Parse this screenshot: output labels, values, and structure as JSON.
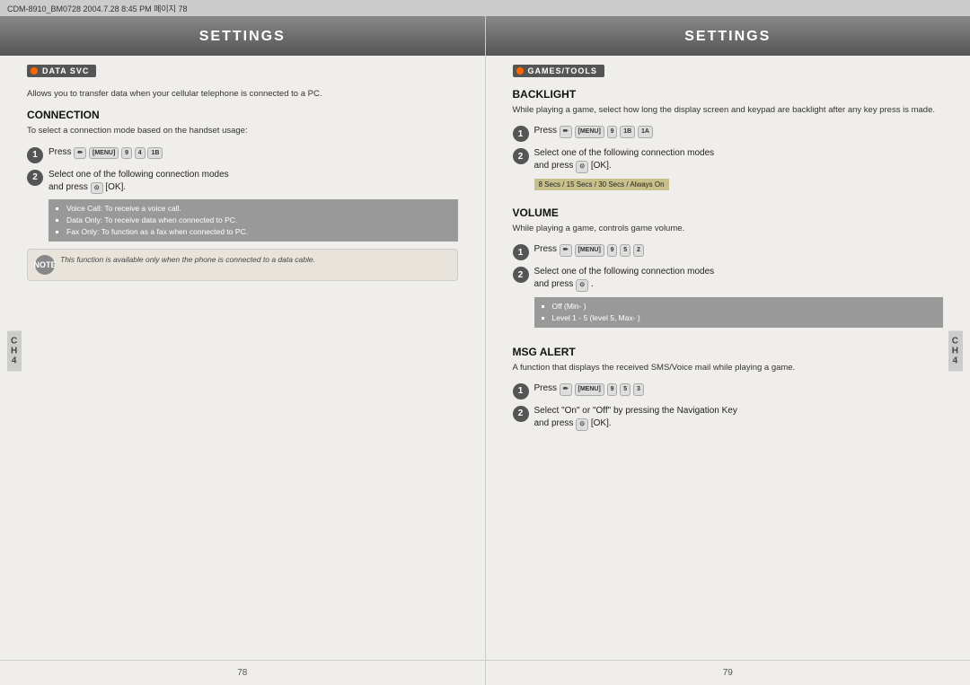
{
  "topbar": {
    "text": "CDM-8910_BM0728  2004.7.28 8:45 PM  페이지 78"
  },
  "leftPage": {
    "header": "SETTINGS",
    "badge": "DATA SVC",
    "badgeDesc": "Allows you to transfer data when your cellular telephone is connected to a PC.",
    "connection": {
      "title": "CONNECTION",
      "desc": "To select a connection mode based on the handset usage:",
      "step1": {
        "num": "1",
        "text": "Press",
        "menu": "[MENU]",
        "keys": [
          "9",
          "4",
          "1B"
        ]
      },
      "step2": {
        "num": "2",
        "text": "Select one of the following connection modes and press",
        "ok": "[OK]."
      },
      "bullets": [
        "Voice Call: To receive a voice call.",
        "Data Only: To receive data when connected to PC.",
        "Fax Only: To function as a fax when connected to PC."
      ],
      "note": "This function is available only when the phone is connected to a data cable."
    },
    "ch": "C\nH\n4",
    "pageNum": "78"
  },
  "rightPage": {
    "header": "SETTINGS",
    "badge": "GAMES/TOOLS",
    "backlight": {
      "title": "BACKLIGHT",
      "desc": "While playing a game, select how long the display screen and keypad are backlight after any key press is made.",
      "step1": {
        "num": "1",
        "text": "Press",
        "menu": "[MENU]",
        "keys": [
          "9",
          "1B",
          "1A"
        ]
      },
      "step2": {
        "num": "2",
        "text": "Select one of the following connection modes and press",
        "ok": "[OK]."
      },
      "highlight": "8 Secs / 15 Secs / 30 Secs / Always On"
    },
    "volume": {
      "title": "VOLUME",
      "desc": "While playing a game, controls game volume.",
      "step1": {
        "num": "1",
        "text": "Press",
        "menu": "[MENU]",
        "keys": [
          "9",
          "5",
          "2"
        ]
      },
      "step2": {
        "num": "2",
        "text": "Select one of the following connection modes and press",
        "ok": "."
      },
      "bullets": [
        "Off (Min- )",
        "Level 1 - 5 (level 5, Max- )"
      ]
    },
    "msgAlert": {
      "title": "MSG ALERT",
      "desc": "A function that displays the received SMS/Voice mail while playing a game.",
      "step1": {
        "num": "1",
        "text": "Press",
        "menu": "[MENU]",
        "keys": [
          "9",
          "5",
          "3"
        ]
      },
      "step2": {
        "num": "2",
        "text": "Select \"On\" or \"Off\" by pressing the Navigation Key and press",
        "ok": "[OK]."
      }
    },
    "ch": "C\nH\n4",
    "pageNum": "79"
  }
}
